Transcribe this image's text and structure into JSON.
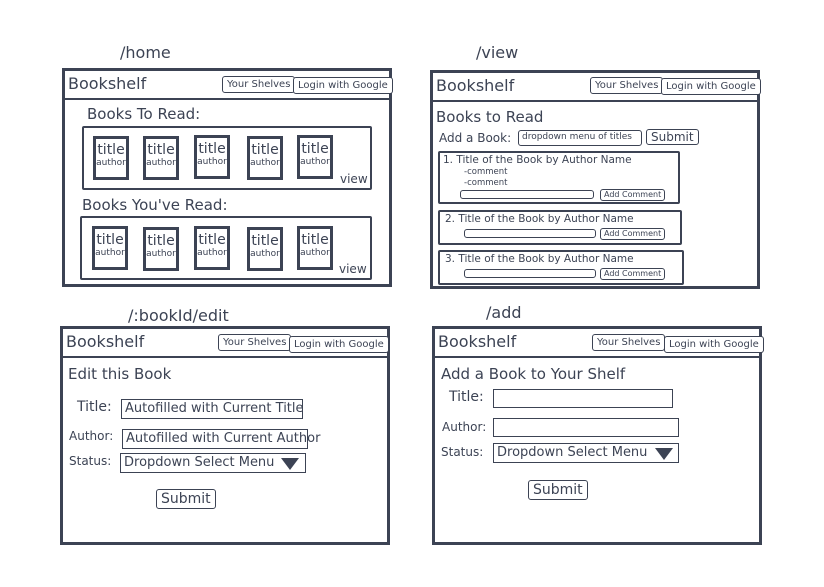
{
  "app": {
    "brand": "Bookshelf",
    "your_shelves": "Your Shelves",
    "login": "Login with Google"
  },
  "home": {
    "route": "/home",
    "to_read_heading": "Books To Read:",
    "read_heading": "Books You've Read:",
    "book_title": "title",
    "book_author": "author",
    "view_link": "view"
  },
  "view": {
    "route": "/view",
    "heading": "Books to Read",
    "add_label": "Add a Book:",
    "dropdown": "dropdown menu of titles",
    "submit": "Submit",
    "entries": [
      "1. Title of the Book by Author Name",
      "2. Title of the Book by Author Name",
      "3. Title of the Book by Author Name"
    ],
    "comment": "-comment",
    "add_comment": "Add Comment"
  },
  "edit": {
    "route": "/:bookId/edit",
    "heading": "Edit this Book",
    "title_label": "Title:",
    "title_value": "Autofilled with Current Title",
    "author_label": "Author:",
    "author_value": "Autofilled with Current Author",
    "status_label": "Status:",
    "status_value": "Dropdown Select Menu",
    "submit": "Submit"
  },
  "add": {
    "route": "/add",
    "heading": "Add a Book to Your Shelf",
    "title_label": "Title:",
    "author_label": "Author:",
    "status_label": "Status:",
    "status_value": "Dropdown Select Menu",
    "submit": "Submit"
  },
  "colors": {
    "ink": "#3c4354",
    "background": "#ffffff"
  }
}
